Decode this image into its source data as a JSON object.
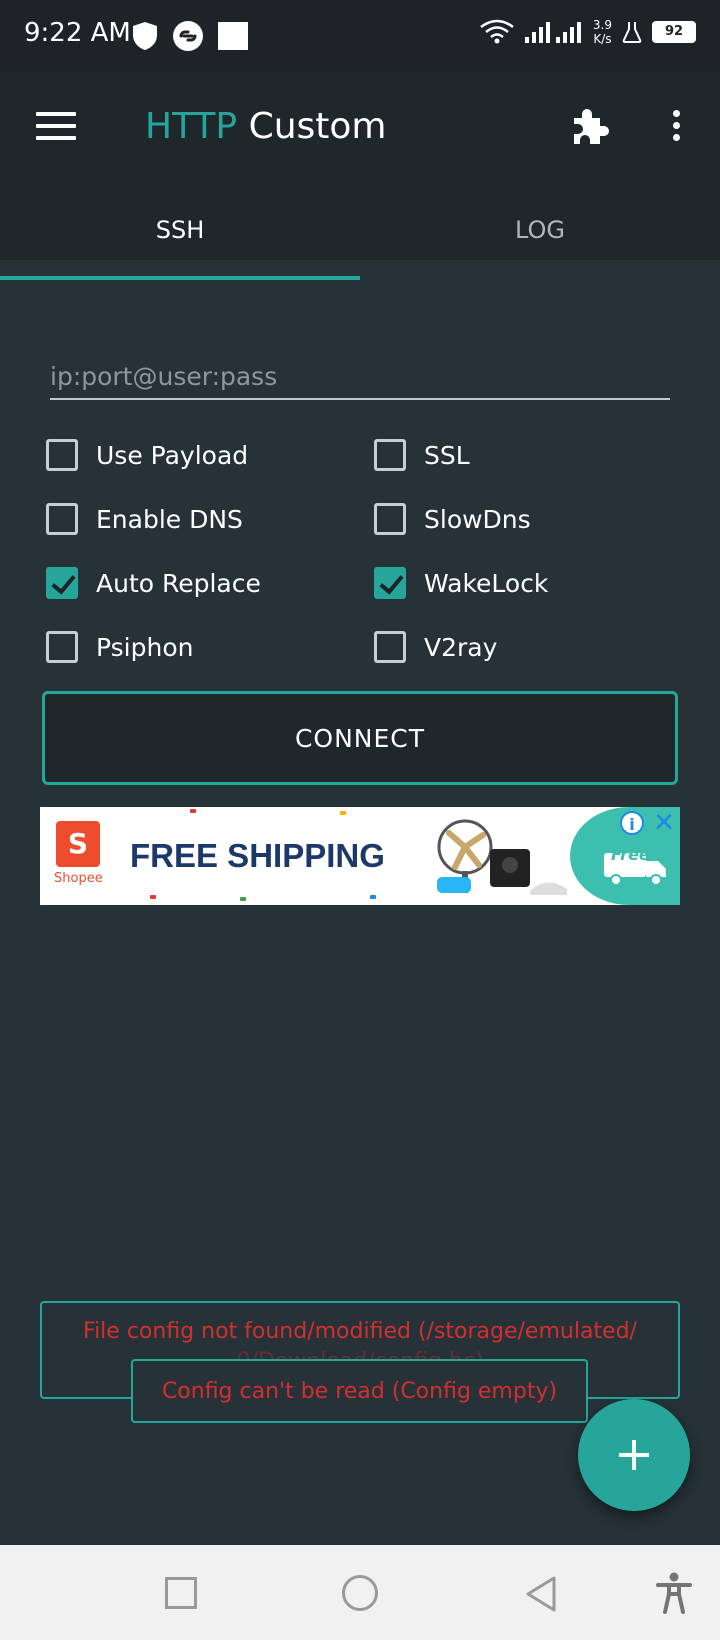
{
  "status_bar": {
    "time": "9:22 AM",
    "net_speed_value": "3.9",
    "net_speed_unit": "K/s",
    "battery": "92",
    "icons": [
      "shield-icon",
      "link-icon",
      "square-notification-icon",
      "wifi-icon",
      "signal-icon",
      "flask-icon",
      "battery-icon"
    ]
  },
  "app_bar": {
    "title_accent": "HTTP",
    "title_rest": " Custom",
    "accent_color": "#26a69a"
  },
  "tabs": [
    {
      "label": "SSH",
      "active": true
    },
    {
      "label": "LOG",
      "active": false
    }
  ],
  "server_input": {
    "placeholder": "ip:port@user:pass",
    "value": ""
  },
  "options": {
    "use_payload": {
      "label": "Use Payload",
      "checked": false
    },
    "ssl": {
      "label": "SSL",
      "checked": false
    },
    "enable_dns": {
      "label": "Enable DNS",
      "checked": false
    },
    "slowdns": {
      "label": "SlowDns",
      "checked": false
    },
    "auto_replace": {
      "label": "Auto Replace",
      "checked": true
    },
    "wakelock": {
      "label": "WakeLock",
      "checked": true
    },
    "psiphon": {
      "label": "Psiphon",
      "checked": false
    },
    "v2ray": {
      "label": "V2ray",
      "checked": false
    }
  },
  "connect_label": "CONNECT",
  "ad": {
    "logo_letter": "S",
    "logo_text": "Shopee",
    "headline": "FREE SHIPPING",
    "badge_text": "Free",
    "info_glyph": "i",
    "close_glyph": "✕"
  },
  "toasts": {
    "file_config_line1": "File config not found/modified (/storage/emulated/",
    "file_config_line2": "0/Download/config.hc)",
    "config_empty": "Config can't be read (Config empty)"
  }
}
